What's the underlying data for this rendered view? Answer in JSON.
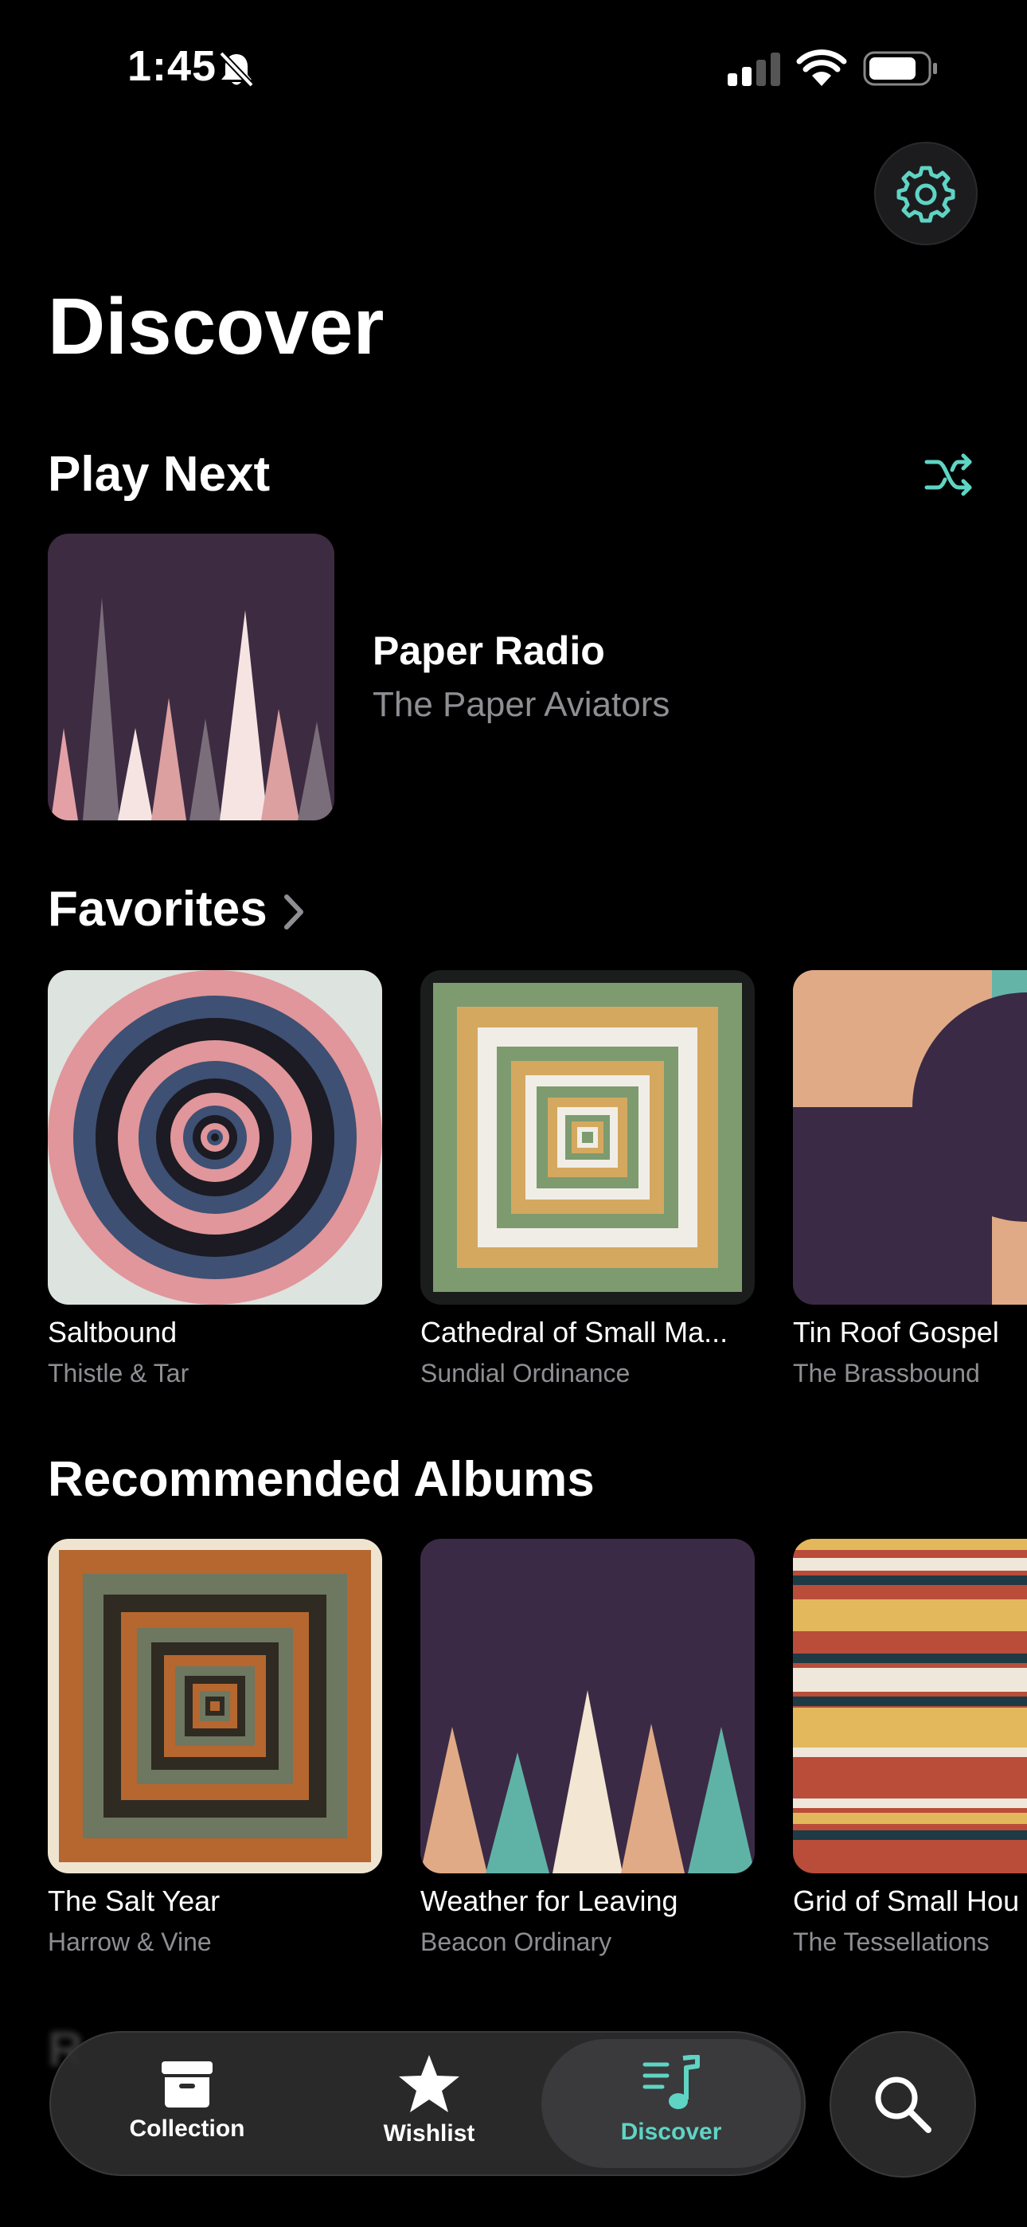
{
  "status_bar": {
    "time": "1:45"
  },
  "page": {
    "title": "Discover"
  },
  "play_next": {
    "heading": "Play Next",
    "item": {
      "title": "Paper Radio",
      "artist": "The Paper Aviators"
    }
  },
  "favorites": {
    "heading": "Favorites",
    "items": [
      {
        "title": "Saltbound",
        "artist": "Thistle & Tar"
      },
      {
        "title": "Cathedral of Small Ma...",
        "artist": "Sundial Ordinance"
      },
      {
        "title": "Tin Roof Gospel",
        "artist": "The Brassbound"
      }
    ]
  },
  "recommended": {
    "heading": "Recommended Albums",
    "items": [
      {
        "title": "The Salt Year",
        "artist": "Harrow & Vine"
      },
      {
        "title": "Weather for Leaving",
        "artist": "Beacon Ordinary"
      },
      {
        "title": "Grid of Small Hou",
        "artist": "The Tessellations"
      }
    ]
  },
  "tabs": [
    {
      "label": "Collection",
      "icon": "archive-box-icon",
      "active": false
    },
    {
      "label": "Wishlist",
      "icon": "star-icon",
      "active": false
    },
    {
      "label": "Discover",
      "icon": "music-list-icon",
      "active": true
    }
  ],
  "colors": {
    "accent": "#5fd4c4",
    "background": "#000000",
    "secondary_text": "#8e8e93"
  }
}
